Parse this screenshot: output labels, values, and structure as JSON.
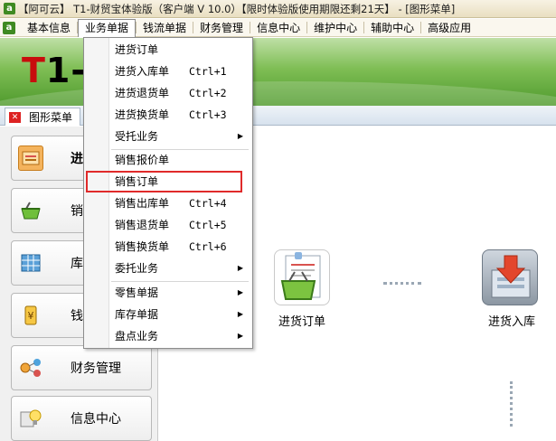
{
  "window": {
    "title": "【阿可云】 T1-财贸宝体验版（客户端 V 10.0）【限时体验版使用期限还剩21天】 - [图形菜单]"
  },
  "menubar": {
    "items": [
      "基本信息",
      "业务单据",
      "钱流单据",
      "财务管理",
      "信息中心",
      "维护中心",
      "辅助中心",
      "高级应用"
    ],
    "active_index": 1
  },
  "banner": {
    "logo_t": "T",
    "logo_one": "1",
    "logo_dash": "-"
  },
  "tab": {
    "label": "图形菜单"
  },
  "leftnav": {
    "items": [
      {
        "label": "进",
        "icon": "purchase-order-icon"
      },
      {
        "label": "销",
        "icon": "sales-basket-icon"
      },
      {
        "label": "库",
        "icon": "inventory-grid-icon"
      },
      {
        "label": "钱",
        "icon": "money-icon"
      },
      {
        "label": "财务管理",
        "icon": "finance-nodes-icon"
      },
      {
        "label": "信息中心",
        "icon": "info-bulb-icon"
      }
    ]
  },
  "main": {
    "flow": [
      {
        "label": "进货订单",
        "icon": "purchase-order-basket-icon"
      },
      {
        "label": "进货入库",
        "icon": "stock-in-arrow-icon"
      }
    ]
  },
  "dropdown": {
    "items": [
      {
        "label": "进货订单",
        "shortcut": "",
        "submenu": false
      },
      {
        "label": "进货入库单",
        "shortcut": "Ctrl+1",
        "submenu": false
      },
      {
        "label": "进货退货单",
        "shortcut": "Ctrl+2",
        "submenu": false
      },
      {
        "label": "进货换货单",
        "shortcut": "Ctrl+3",
        "submenu": false
      },
      {
        "label": "受托业务",
        "shortcut": "",
        "submenu": true
      },
      {
        "label": "销售报价单",
        "shortcut": "",
        "submenu": false
      },
      {
        "label": "销售订单",
        "shortcut": "",
        "submenu": false
      },
      {
        "label": "销售出库单",
        "shortcut": "Ctrl+4",
        "submenu": false
      },
      {
        "label": "销售退货单",
        "shortcut": "Ctrl+5",
        "submenu": false
      },
      {
        "label": "销售换货单",
        "shortcut": "Ctrl+6",
        "submenu": false
      },
      {
        "label": "委托业务",
        "shortcut": "",
        "submenu": true
      },
      {
        "label": "零售单据",
        "shortcut": "",
        "submenu": true
      },
      {
        "label": "库存单据",
        "shortcut": "",
        "submenu": true
      },
      {
        "label": "盘点业务",
        "shortcut": "",
        "submenu": true
      }
    ],
    "highlighted_index": 6
  },
  "colors": {
    "highlight_border": "#e02a2a",
    "banner_green": "#7fbe55",
    "logo_red": "#c80d0d"
  }
}
